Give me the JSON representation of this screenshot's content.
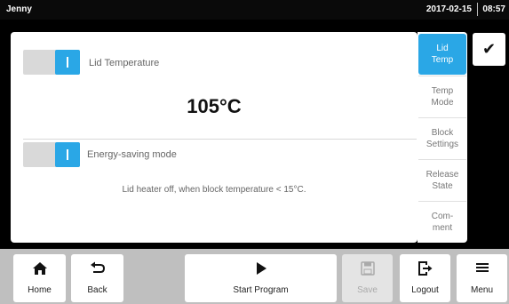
{
  "status_bar": {
    "user": "Jenny",
    "date": "2017-02-15",
    "time": "08:57"
  },
  "main": {
    "lid_temperature_label": "Lid Temperature",
    "lid_temperature_value": "105°C",
    "energy_saving_label": "Energy-saving mode",
    "energy_saving_hint": "Lid heater off, when block temperature < 15°C."
  },
  "tabs": [
    {
      "line1": "Lid",
      "line2": "Temp",
      "active": true
    },
    {
      "line1": "Temp",
      "line2": "Mode"
    },
    {
      "line1": "Block",
      "line2": "Settings"
    },
    {
      "line1": "Release",
      "line2": "State"
    },
    {
      "line1": "Com-",
      "line2": "ment"
    }
  ],
  "toolbar": {
    "home_label": "Home",
    "back_label": "Back",
    "start_label": "Start Program",
    "save_label": "Save",
    "logout_label": "Logout",
    "menu_label": "Menu"
  },
  "icons": {
    "confirm": "check-icon",
    "home": "home-icon",
    "back": "back-arrow-icon",
    "start": "play-icon",
    "save": "floppy-disk-icon",
    "logout": "logout-icon",
    "menu": "hamburger-menu-icon"
  },
  "colors": {
    "accent": "#2aa7e6",
    "background": "#000000",
    "toolbar": "#bfbfbf"
  }
}
